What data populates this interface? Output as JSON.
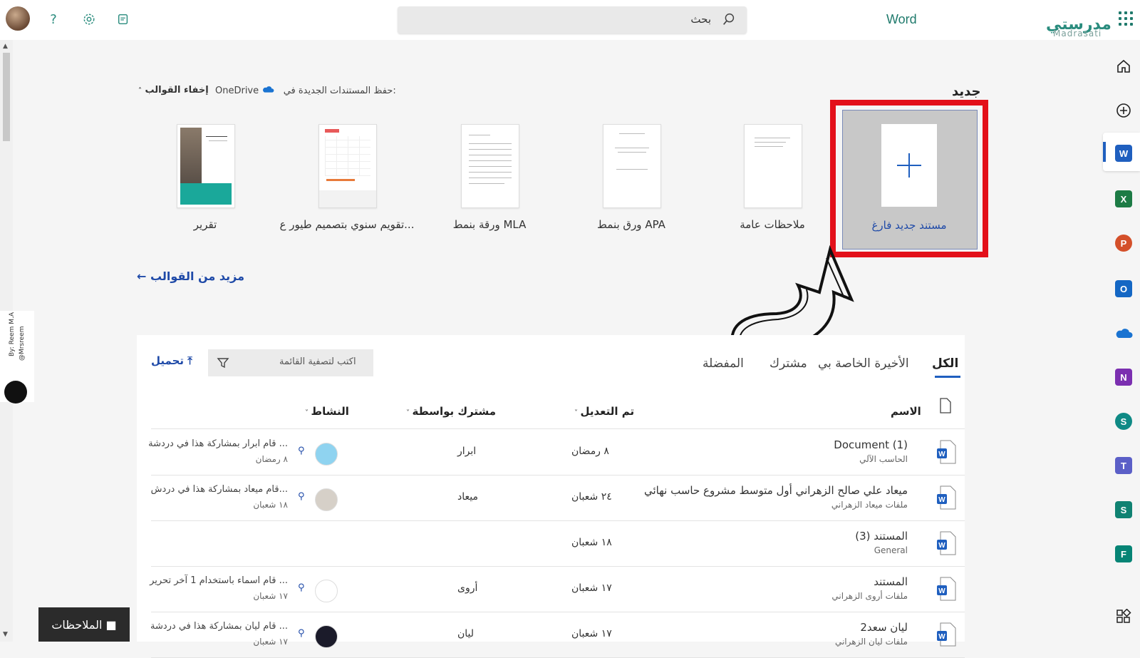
{
  "header": {
    "app_name": "Word",
    "search_label": "بحث",
    "logo_text": "مدرستي",
    "logo_sub": "Madrasati"
  },
  "new_section": {
    "title": "جديد",
    "save_info_prefix": "حفظ المستندات الجديدة في:",
    "save_location": "OneDrive",
    "hide_templates": "إخفاء القوالب",
    "blank_label": "مستند جديد فارغ",
    "templates": [
      {
        "label": "ملاحظات عامة"
      },
      {
        "label": "ورق بنمط APA"
      },
      {
        "label": "ورقة بنمط MLA"
      },
      {
        "label": "تقويم سنوي بتصميم طيور ع..."
      },
      {
        "label": "تقرير"
      }
    ],
    "more_templates": "مزيد من القوالب"
  },
  "tabs": [
    "الكل",
    "الأخيرة الخاصة بي",
    "مشترك",
    "المفضلة"
  ],
  "filter_placeholder": "اكتب لتصفية القائمة",
  "upload_label": "تحميل",
  "columns": {
    "name": "الاسم",
    "modified": "تم التعديل",
    "shared_by": "مشترك بواسطة",
    "activity": "النشاط"
  },
  "files": [
    {
      "name": "Document (1)",
      "location": "الحاسب الآلي",
      "modified": "٨ رمضان",
      "shared_by": "ابرار",
      "activity": "قام ابرار بمشاركة هذا في دردشة ...",
      "activity_date": "٨ رمضان"
    },
    {
      "name": "ميعاد علي صالح الزهراني أول متوسط مشروع حاسب نهائي",
      "location": "ملفات ميعاد الزهراني",
      "modified": "٢٤ شعبان",
      "shared_by": "ميعاد",
      "activity": "قام ميعاد بمشاركة هذا في دردش...",
      "activity_date": "١٨ شعبان"
    },
    {
      "name": "المستند (3)",
      "location": "General",
      "modified": "١٨ شعبان",
      "shared_by": "",
      "activity": "",
      "activity_date": ""
    },
    {
      "name": "المستند",
      "location": "ملفات أروى الزهراني",
      "modified": "١٧ شعبان",
      "shared_by": "أروى",
      "activity": "قام اسماء باستخدام 1 آخر تحرير ...",
      "activity_date": "١٧ شعبان"
    },
    {
      "name": "ليان سعد2",
      "location": "ملفات ليان الزهراني",
      "modified": "١٧ شعبان",
      "shared_by": "ليان",
      "activity": "قام ليان بمشاركة هذا في دردشة ...",
      "activity_date": "١٧ شعبان"
    }
  ],
  "notes_button": "الملاحظات",
  "watermark": {
    "line1": "By: Reem M.A",
    "line2": "@Mrsreem"
  },
  "colors": {
    "accent": "#1f5fbf",
    "brand": "#1f7a6c",
    "highlight": "#e3101a"
  }
}
